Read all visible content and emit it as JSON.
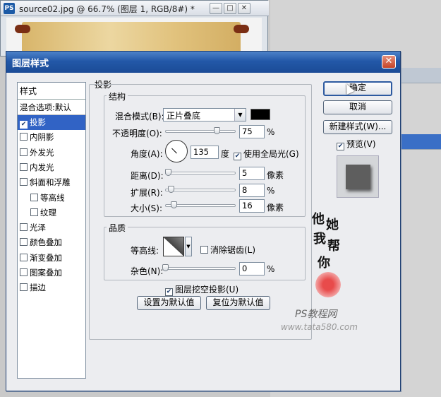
{
  "doc_window": {
    "title": "source02.jpg @ 66.7% (图层 1, RGB/8#) *",
    "app_icon": "PS"
  },
  "dialog": {
    "title": "图层样式",
    "close_icon": "close-icon"
  },
  "style_list": {
    "header": "样式",
    "blend_options": "混合选项:默认",
    "items": [
      {
        "label": "投影",
        "checked": true,
        "selected": true
      },
      {
        "label": "内阴影",
        "checked": false
      },
      {
        "label": "外发光",
        "checked": false
      },
      {
        "label": "内发光",
        "checked": false
      },
      {
        "label": "斜面和浮雕",
        "checked": false
      },
      {
        "label": "等高线",
        "checked": false,
        "sub": true
      },
      {
        "label": "纹理",
        "checked": false,
        "sub": true
      },
      {
        "label": "光泽",
        "checked": false
      },
      {
        "label": "颜色叠加",
        "checked": false
      },
      {
        "label": "渐变叠加",
        "checked": false
      },
      {
        "label": "图案叠加",
        "checked": false
      },
      {
        "label": "描边",
        "checked": false
      }
    ]
  },
  "drop_shadow": {
    "section_title": "投影",
    "structure_title": "结构",
    "blend_mode_label": "混合模式(B):",
    "blend_mode_value": "正片叠底",
    "shadow_color": "#000000",
    "opacity_label": "不透明度(O):",
    "opacity_value": "75",
    "opacity_unit": "%",
    "angle_label": "角度(A):",
    "angle_value": "135",
    "angle_unit": "度",
    "global_light_label": "使用全局光(G)",
    "global_light_checked": true,
    "distance_label": "距离(D):",
    "distance_value": "5",
    "distance_unit": "像素",
    "spread_label": "扩展(R):",
    "spread_value": "8",
    "spread_unit": "%",
    "size_label": "大小(S):",
    "size_value": "16",
    "size_unit": "像素",
    "quality_title": "品质",
    "contour_label": "等高线:",
    "anti_alias_label": "消除锯齿(L)",
    "anti_alias_checked": false,
    "noise_label": "杂色(N):",
    "noise_value": "0",
    "noise_unit": "%",
    "knockout_label": "图层挖空投影(U)",
    "knockout_checked": true,
    "make_default_label": "设置为默认值",
    "reset_default_label": "复位为默认值"
  },
  "buttons": {
    "ok": "确定",
    "cancel": "取消",
    "new_style": "新建样式(W)...",
    "preview_label": "预览(V)",
    "preview_checked": true
  },
  "watermark": {
    "chars": [
      "他",
      "她",
      "我",
      "帮",
      "你"
    ],
    "line1": "PS教程网",
    "line2": "www.tata580.com"
  }
}
